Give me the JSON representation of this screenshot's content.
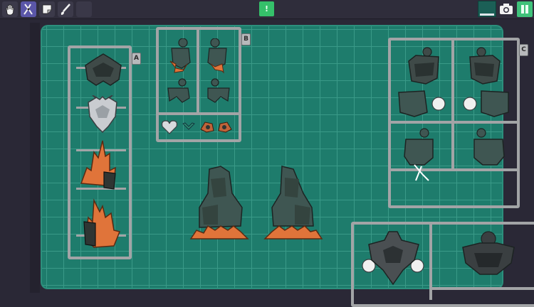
{
  "toolbar": {
    "tools": [
      {
        "name": "hand-icon",
        "active": false
      },
      {
        "name": "nipper-icon",
        "active": true
      },
      {
        "name": "sticker-icon",
        "active": false
      },
      {
        "name": "paint-brush-icon",
        "active": false
      },
      {
        "name": "empty-slot",
        "active": false
      }
    ],
    "hint_label": "!",
    "color_swatch": "#1b5f56",
    "camera_icon": "camera-icon",
    "pause_icon": "pause-icon"
  },
  "runners": {
    "a": {
      "label": "A"
    },
    "b": {
      "label": "B"
    },
    "c": {
      "label": "C"
    }
  },
  "colors": {
    "mat": "#1e7c6c",
    "grid": "#3a9a88",
    "runner": "#a2a4a6",
    "armor": "#3f5652",
    "orange": "#e0743a",
    "silver": "#c9ccd0"
  }
}
